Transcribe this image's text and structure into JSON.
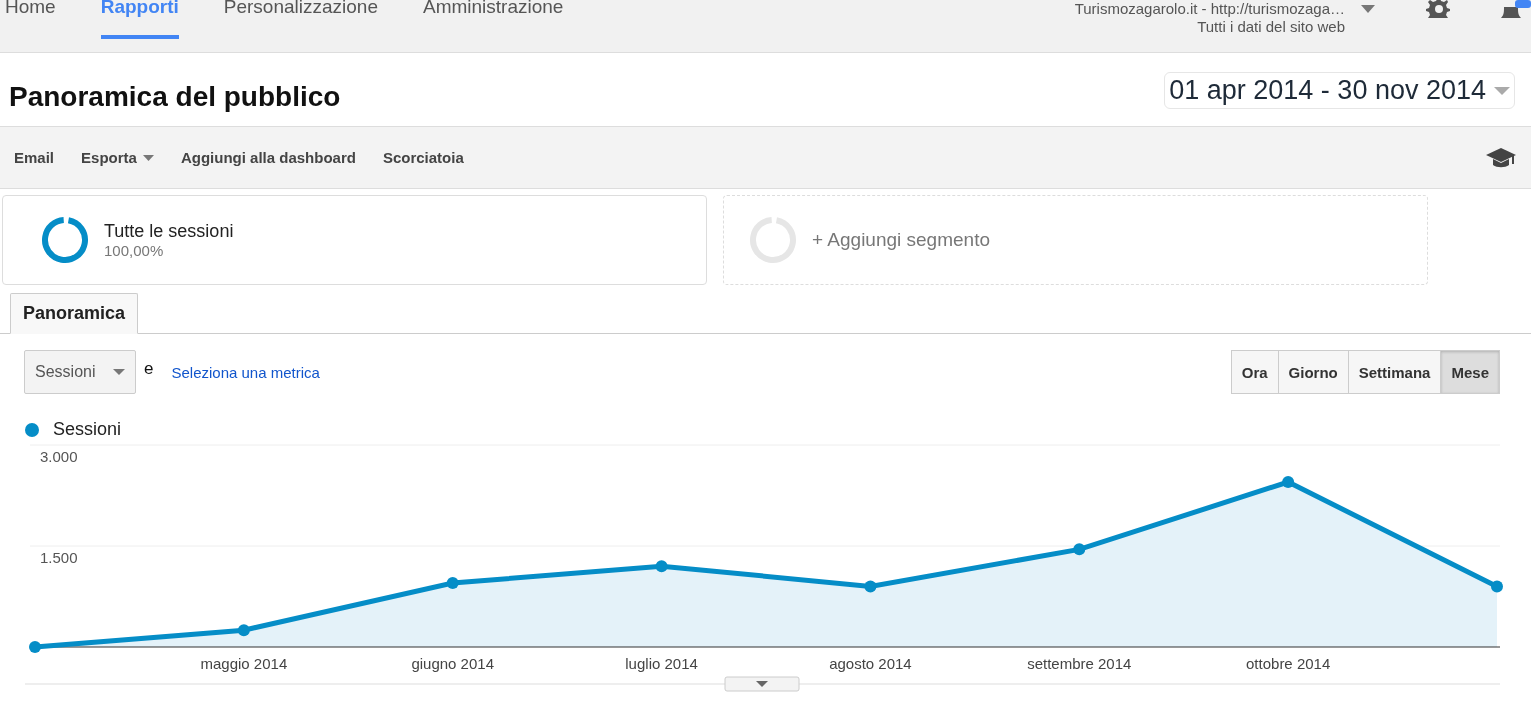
{
  "nav": {
    "tabs": [
      {
        "label": "Home",
        "selected": false
      },
      {
        "label": "Rapporti",
        "selected": true
      },
      {
        "label": "Personalizzazione",
        "selected": false
      },
      {
        "label": "Amministrazione",
        "selected": false
      }
    ],
    "account": {
      "property": "Turismozagarolo.it - http://turismozaga…",
      "view": "Tutti i dati del sito web"
    }
  },
  "header": {
    "title": "Panoramica del pubblico",
    "date_range": "01 apr 2014 - 30 nov 2014"
  },
  "toolbar": [
    {
      "label": "Email",
      "kind": "plain"
    },
    {
      "label": "Esporta",
      "kind": "menu"
    },
    {
      "label": "Aggiungi alla dashboard",
      "kind": "plain"
    },
    {
      "label": "Scorciatoia",
      "kind": "plain"
    }
  ],
  "segments": [
    {
      "kind": "segment",
      "name": "Tutte le sessioni",
      "share": "100,00%"
    },
    {
      "kind": "add",
      "name": "+ Aggiungi segmento"
    }
  ],
  "report_tabs": [
    {
      "label": "Panoramica",
      "selected": true
    }
  ],
  "metric": {
    "value": "Sessioni",
    "joiner": "e",
    "link": "Seleziona una metrica"
  },
  "periods": [
    {
      "label": "Ora",
      "selected": false
    },
    {
      "label": "Giorno",
      "selected": false
    },
    {
      "label": "Settimana",
      "selected": false
    },
    {
      "label": "Mese",
      "selected": true
    }
  ],
  "chart": {
    "chart_data": {
      "type": "area",
      "categories": [
        null,
        "maggio 2014",
        "giugno 2014",
        "luglio 2014",
        "agosto 2014",
        "settembre 2014",
        "ottobre 2014",
        null
      ],
      "yticks": [
        {
          "value": 1500,
          "label": "1.500"
        },
        {
          "value": 3000,
          "label": "3.000"
        }
      ],
      "ylim": [
        0,
        3000
      ],
      "series": [
        {
          "name": "Sessioni",
          "color": "#058dc7",
          "values": [
            0,
            250,
            950,
            1200,
            900,
            1450,
            2450,
            900
          ]
        }
      ]
    }
  }
}
